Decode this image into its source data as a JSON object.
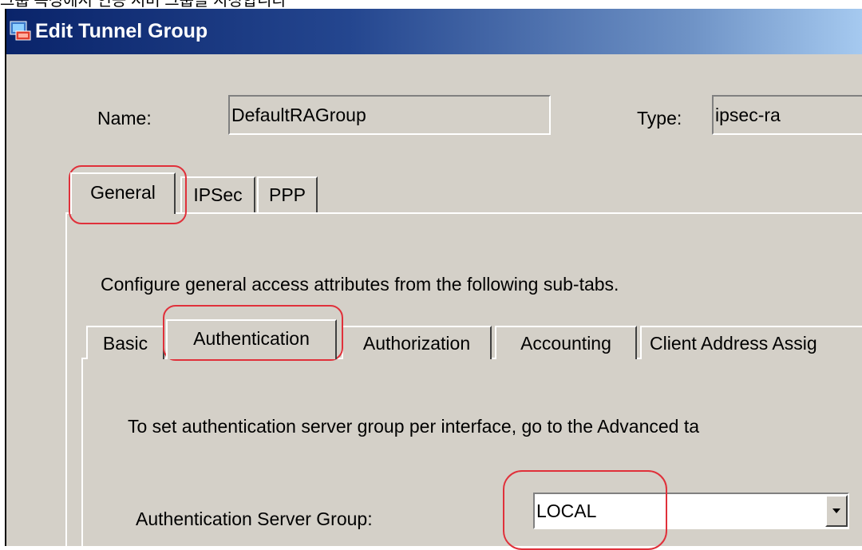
{
  "caption": "그룹 속성에서 인증 서버 그룹을 지정합니다",
  "window": {
    "title": "Edit Tunnel Group"
  },
  "fields": {
    "name_label": "Name:",
    "name_value": "DefaultRAGroup",
    "type_label": "Type:",
    "type_value": "ipsec-ra"
  },
  "main_tabs": [
    "General",
    "IPSec",
    "PPP"
  ],
  "general": {
    "description": "Configure general access attributes from the following sub-tabs."
  },
  "sub_tabs": [
    "Basic",
    "Authentication",
    "Authorization",
    "Accounting",
    "Client Address Assig"
  ],
  "authentication": {
    "info": "To set authentication server group per interface, go to the Advanced ta",
    "server_group_label": "Authentication Server Group:",
    "server_group_value": "LOCAL"
  },
  "colors": {
    "highlight_red": "#e0303a",
    "title_blue": "#0a246a",
    "dialog_gray": "#d4d0c8"
  }
}
